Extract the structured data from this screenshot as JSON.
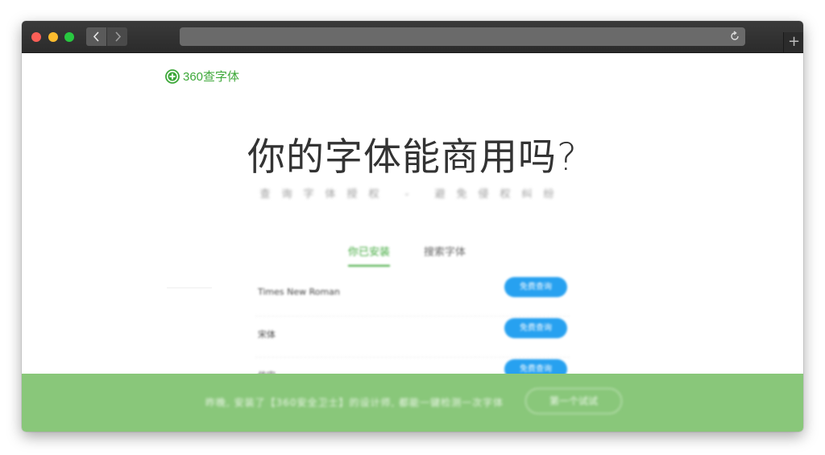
{
  "browser": {
    "icons": {
      "close": "close-dot",
      "minimize": "minimize-dot",
      "zoom": "zoom-dot",
      "back": "chevron-left-icon",
      "forward": "chevron-right-icon",
      "reload": "reload-icon",
      "new_tab": "plus-icon"
    },
    "new_tab_label": "+"
  },
  "site": {
    "logo_text": "360查字体",
    "brand_color": "#3ea83a"
  },
  "hero": {
    "headline": "你的字体能商用吗?",
    "subline": "查询字体授权 - 避免侵权纠纷"
  },
  "tabs": [
    {
      "label": "你已安装",
      "active": true
    },
    {
      "label": "搜索字体",
      "active": false
    }
  ],
  "fonts": [
    {
      "name": "Times New Roman",
      "button": "免费查询"
    },
    {
      "name": "宋体",
      "button": "免费查询"
    },
    {
      "name": "仿宋",
      "button": "免费查询"
    }
  ],
  "banner": {
    "text": "昨晚, 安装了【360安全卫士】的设计师, 都能一键检测一次字体",
    "button": "第一个试试",
    "color": "#89c77a"
  }
}
